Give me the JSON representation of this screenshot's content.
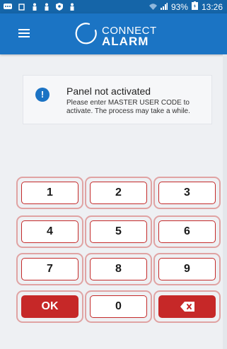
{
  "status_bar": {
    "battery": "93%",
    "time": "13:26",
    "left_icons": [
      "message-icon",
      "cast-icon",
      "person-icon",
      "person-icon",
      "shield-icon",
      "person-icon"
    ],
    "right_icons": [
      "wifi-icon",
      "signal-icon",
      "battery-icon"
    ]
  },
  "app_bar": {
    "menu_icon": "hamburger-menu-icon",
    "logo_line1": "CONNECT",
    "logo_line2": "ALARM",
    "color": "#1b74c4"
  },
  "info": {
    "icon": "exclamation-icon",
    "title": "Panel not activated",
    "message": "Please enter MASTER USER CODE to activate. The process may take a while."
  },
  "keypad": {
    "keys": [
      "1",
      "2",
      "3",
      "4",
      "5",
      "6",
      "7",
      "8",
      "9",
      "OK",
      "0",
      "backspace"
    ],
    "ok_label": "OK",
    "backspace_icon": "backspace-icon",
    "accent_color": "#c62828"
  }
}
